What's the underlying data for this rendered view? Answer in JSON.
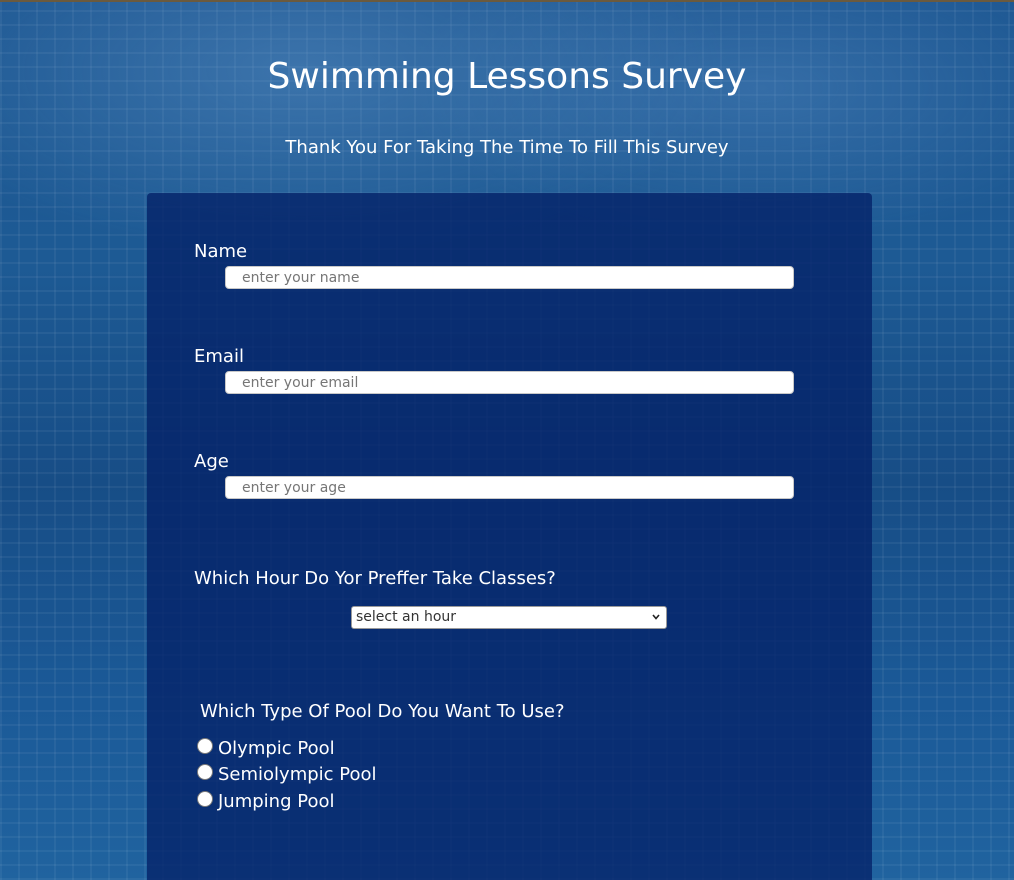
{
  "page": {
    "title": "Swimming Lessons Survey",
    "subtitle": "Thank You For Taking The Time To Fill This Survey"
  },
  "form": {
    "name": {
      "label": "Name",
      "placeholder": "enter your name",
      "value": ""
    },
    "email": {
      "label": "Email",
      "placeholder": "enter your email",
      "value": ""
    },
    "age": {
      "label": "Age",
      "placeholder": "enter your age",
      "value": ""
    },
    "hour": {
      "label": "Which Hour Do Yor Preffer Take Classes?",
      "selected": "select an hour",
      "icon": "chevron-down-icon"
    },
    "pool": {
      "label": "Which Type Of Pool Do You Want To Use?",
      "options": [
        "Olympic Pool",
        "Semiolympic Pool",
        "Jumping Pool"
      ],
      "selected": null
    }
  },
  "colors": {
    "panel": "#042168",
    "background": "#1d5a94",
    "text": "#ffffff"
  }
}
